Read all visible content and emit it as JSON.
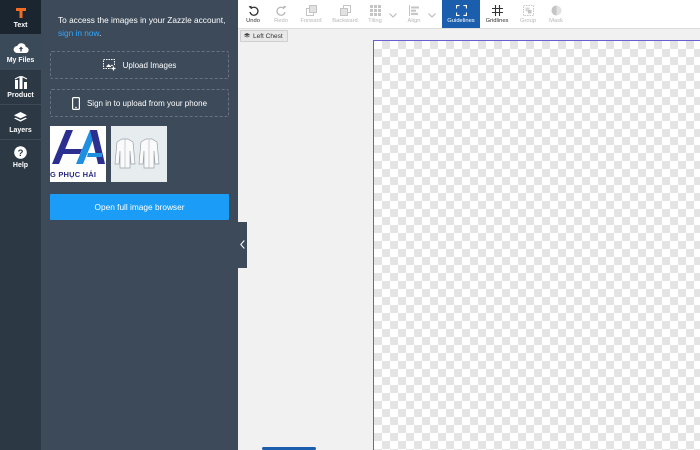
{
  "rail": {
    "items": [
      {
        "label": "Text",
        "icon": "text-t-icon"
      },
      {
        "label": "My Files",
        "icon": "cloud-upload-icon"
      },
      {
        "label": "Product",
        "icon": "product-icon"
      },
      {
        "label": "Layers",
        "icon": "layers-icon"
      },
      {
        "label": "Help",
        "icon": "help-icon"
      }
    ]
  },
  "panel": {
    "intro_text": "To access the images in your Zazzle account,",
    "signin_link": "sign in now",
    "signin_suffix": ".",
    "upload_label": "Upload Images",
    "phone_label": "Sign in to upload from your phone",
    "thumb1_caption": "G PHỤC HẢI",
    "open_browser_label": "Open full image browser"
  },
  "toolbar": {
    "undo": "Undo",
    "redo": "Redo",
    "forward": "Forward",
    "backward": "Backward",
    "tiling": "Tiling",
    "align": "Align",
    "guidelines": "Guidelines",
    "gridlines": "Gridlines",
    "group": "Group",
    "mask": "Mask"
  },
  "canvas": {
    "zone_label": "Left Chest"
  },
  "colors": {
    "rail_bg": "#2c3844",
    "panel_bg": "#3c4a59",
    "accent": "#1a9cf7",
    "guidelines_active": "#1b5eae",
    "text_tool_orange": "#f26b21"
  }
}
